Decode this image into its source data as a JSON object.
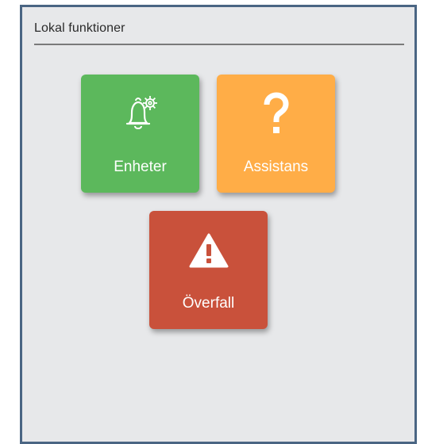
{
  "panel": {
    "title": "Lokal funktioner"
  },
  "tiles": [
    {
      "label": "Enheter",
      "icon": "bell-gear-icon",
      "color": "#5cb85c"
    },
    {
      "label": "Assistans",
      "icon": "question-mark-icon",
      "color": "#ffad47"
    },
    {
      "label": "Överfall",
      "icon": "warning-triangle-icon",
      "color": "#c9513b"
    }
  ],
  "colors": {
    "frame_border": "#4a6583",
    "panel_background": "#e7e8ea"
  }
}
